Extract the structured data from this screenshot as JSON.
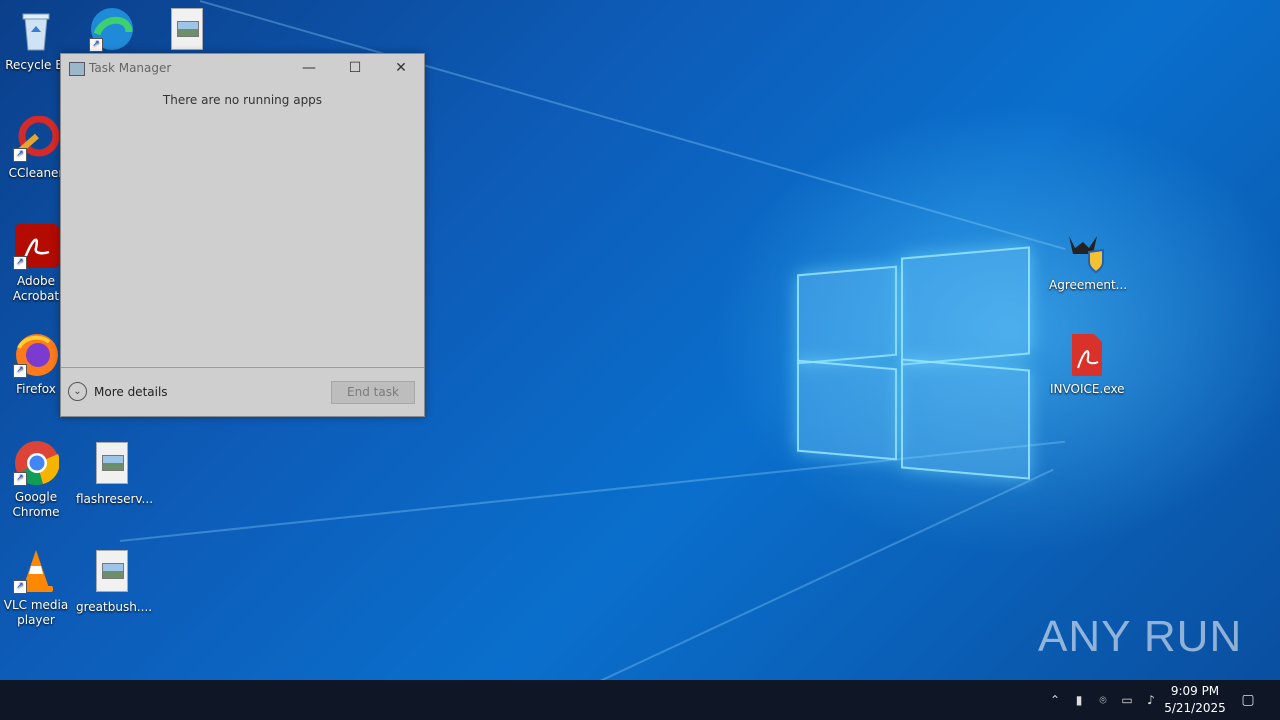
{
  "desktop": {
    "icons_left": [
      {
        "label": "Recycle Bin",
        "display": "Recycle Bi"
      },
      {
        "label": "CCleaner",
        "display": "CCleaner"
      },
      {
        "label": "Adobe Acrobat",
        "display": "Adobe Acrobat"
      },
      {
        "label": "Firefox",
        "display": "Firefox"
      },
      {
        "label": "Google Chrome",
        "display": "Google Chrome"
      },
      {
        "label": "VLC media player",
        "display": "VLC media player"
      }
    ],
    "icons_col2": [
      {
        "display": "flashreserv..."
      },
      {
        "display": "greatbush...."
      }
    ],
    "icons_right": [
      {
        "display": "Agreement..."
      },
      {
        "display": "INVOICE.exe"
      }
    ],
    "watermark": "ANY RUN"
  },
  "task_manager": {
    "title": "Task Manager",
    "message": "There are no running apps",
    "more_details": "More details",
    "end_task": "End task",
    "minimize_glyph": "—",
    "maximize_glyph": "☐",
    "close_glyph": "✕"
  },
  "taskbar": {
    "time": "9:09 PM",
    "date": "5/21/2025"
  }
}
